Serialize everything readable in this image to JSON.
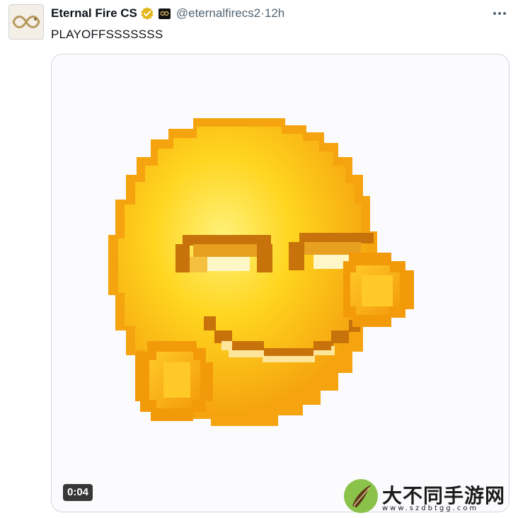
{
  "tweet": {
    "author_name": "Eternal Fire CS",
    "handle": "@eternalfirecs2",
    "separator": " · ",
    "time": "12h",
    "text": "PLAYOFFSSSSSSS"
  },
  "media": {
    "duration": "0:04"
  },
  "watermark": {
    "title": "大不同手游网",
    "url": "www.szdbtgg.com"
  },
  "icons": {
    "verified": "verified-badge-icon",
    "affiliate": "affiliate-badge-icon",
    "more": "more-options-icon"
  },
  "colors": {
    "verified_gold": "#e2b719",
    "handle_gray": "#536471",
    "face_yellow": "#ffd51f",
    "face_orange": "#f39a0b"
  }
}
